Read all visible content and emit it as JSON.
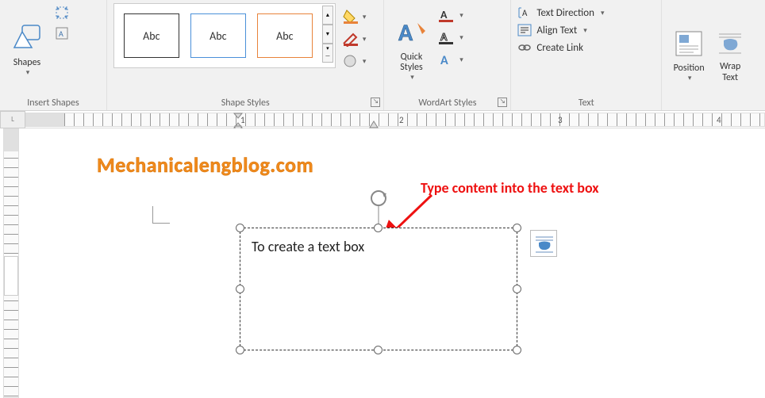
{
  "ribbon": {
    "groups": {
      "insertShapes": {
        "label": "Insert Shapes",
        "shapesBtn": "Shapes"
      },
      "shapeStyles": {
        "label": "Shape Styles",
        "galleryItems": [
          "Abc",
          "Abc",
          "Abc"
        ]
      },
      "wordartStyles": {
        "label": "WordArt Styles",
        "quickStylesBtn": "Quick\nStyles"
      },
      "text": {
        "label": "Text",
        "textDirection": "Text Direction",
        "alignText": "Align Text",
        "createLink": "Create Link"
      },
      "arrange": {
        "positionBtn": "Position",
        "wrapTextBtn": "Wrap\nText"
      }
    }
  },
  "ruler": {
    "numbers": [
      "1",
      "2",
      "3",
      "4"
    ]
  },
  "document": {
    "watermark": "Mechanicalengblog.com",
    "textboxContent": "To create a text box",
    "annotation": "Type content into the text box"
  }
}
